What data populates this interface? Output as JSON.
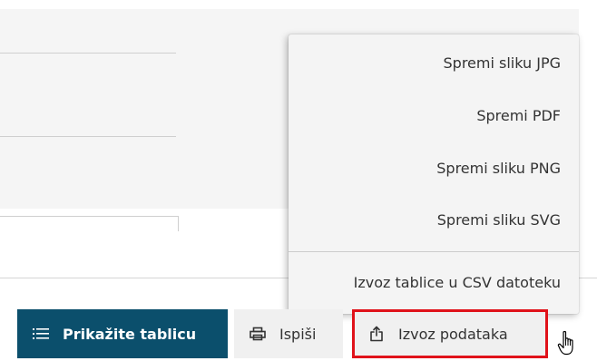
{
  "menu": {
    "items": [
      {
        "label": "Spremi sliku JPG"
      },
      {
        "label": "Spremi PDF"
      },
      {
        "label": "Spremi sliku PNG"
      },
      {
        "label": "Spremi sliku SVG"
      },
      {
        "label": "Izvoz tablice u CSV datoteku"
      }
    ]
  },
  "toolbar": {
    "show_table_label": "Prikažite tablicu",
    "print_label": "Ispiši",
    "export_label": "Izvoz podataka"
  },
  "colors": {
    "primary_button": "#0b4f6c",
    "highlight_border": "#e0121a"
  },
  "icons": {
    "show_table": "list-icon",
    "print": "printer-icon",
    "export": "share-upload-icon",
    "cursor": "hand-pointer-icon"
  }
}
